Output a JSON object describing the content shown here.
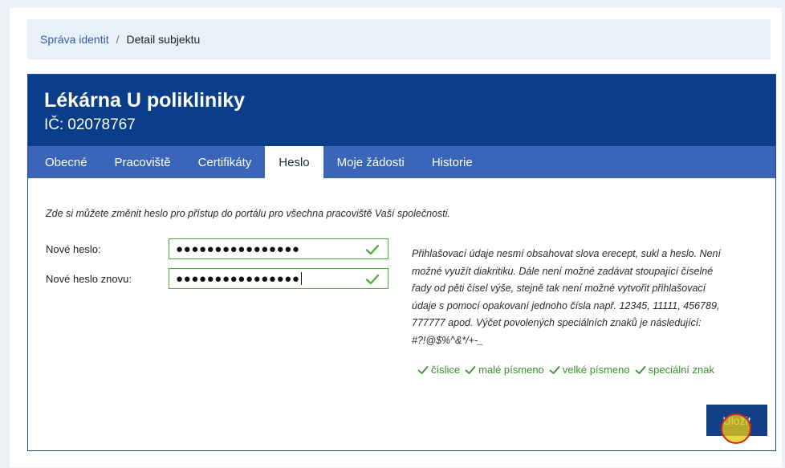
{
  "breadcrumb": {
    "link": "Správa identit",
    "separator": "/",
    "current": "Detail subjektu"
  },
  "subject": {
    "title": "Lékárna U polikliniky",
    "ic_label": "IČ:",
    "ic_value": "02078767"
  },
  "tabs": [
    {
      "label": "Obecné",
      "active": false
    },
    {
      "label": "Pracoviště",
      "active": false
    },
    {
      "label": "Certifikáty",
      "active": false
    },
    {
      "label": "Heslo",
      "active": true
    },
    {
      "label": "Moje žádosti",
      "active": false
    },
    {
      "label": "Historie",
      "active": false
    }
  ],
  "password_form": {
    "intro": "Zde si můžete změnit heslo pro přístup do portálu pro všechna pracoviště Vaší společnosti.",
    "new_password_label": "Nové heslo:",
    "new_password_value": "●●●●●●●●●●●●●●●●",
    "repeat_password_label": "Nové heslo znovu:",
    "repeat_password_value": "●●●●●●●●●●●●●●●●",
    "rules_lines": [
      "Přihlašovací údaje nesmí obsahovat slova erecept, sukl a heslo. Není",
      "možné využít diakritiku. Dále není možné zadávat stoupající číselné",
      "řady od pěti čísel výše, stejně tak není možné vytvořit přihlašovací",
      "údaje s pomocí opakovaní jednoho čísla např. 12345, 11111, 456789,",
      "777777 apod. Výčet povolených speciálních znaků je následující:",
      "#?!@$%^&*/+-_"
    ],
    "requirements": [
      "číslice",
      "malé písmeno",
      "velké písmeno",
      "speciální znak"
    ],
    "save_label": "Uložit"
  },
  "colors": {
    "header_bg": "#0a3e8a",
    "tab_bar_bg": "#3a65b8",
    "valid_green": "#3a8f2e",
    "button_bg": "#123f85"
  }
}
